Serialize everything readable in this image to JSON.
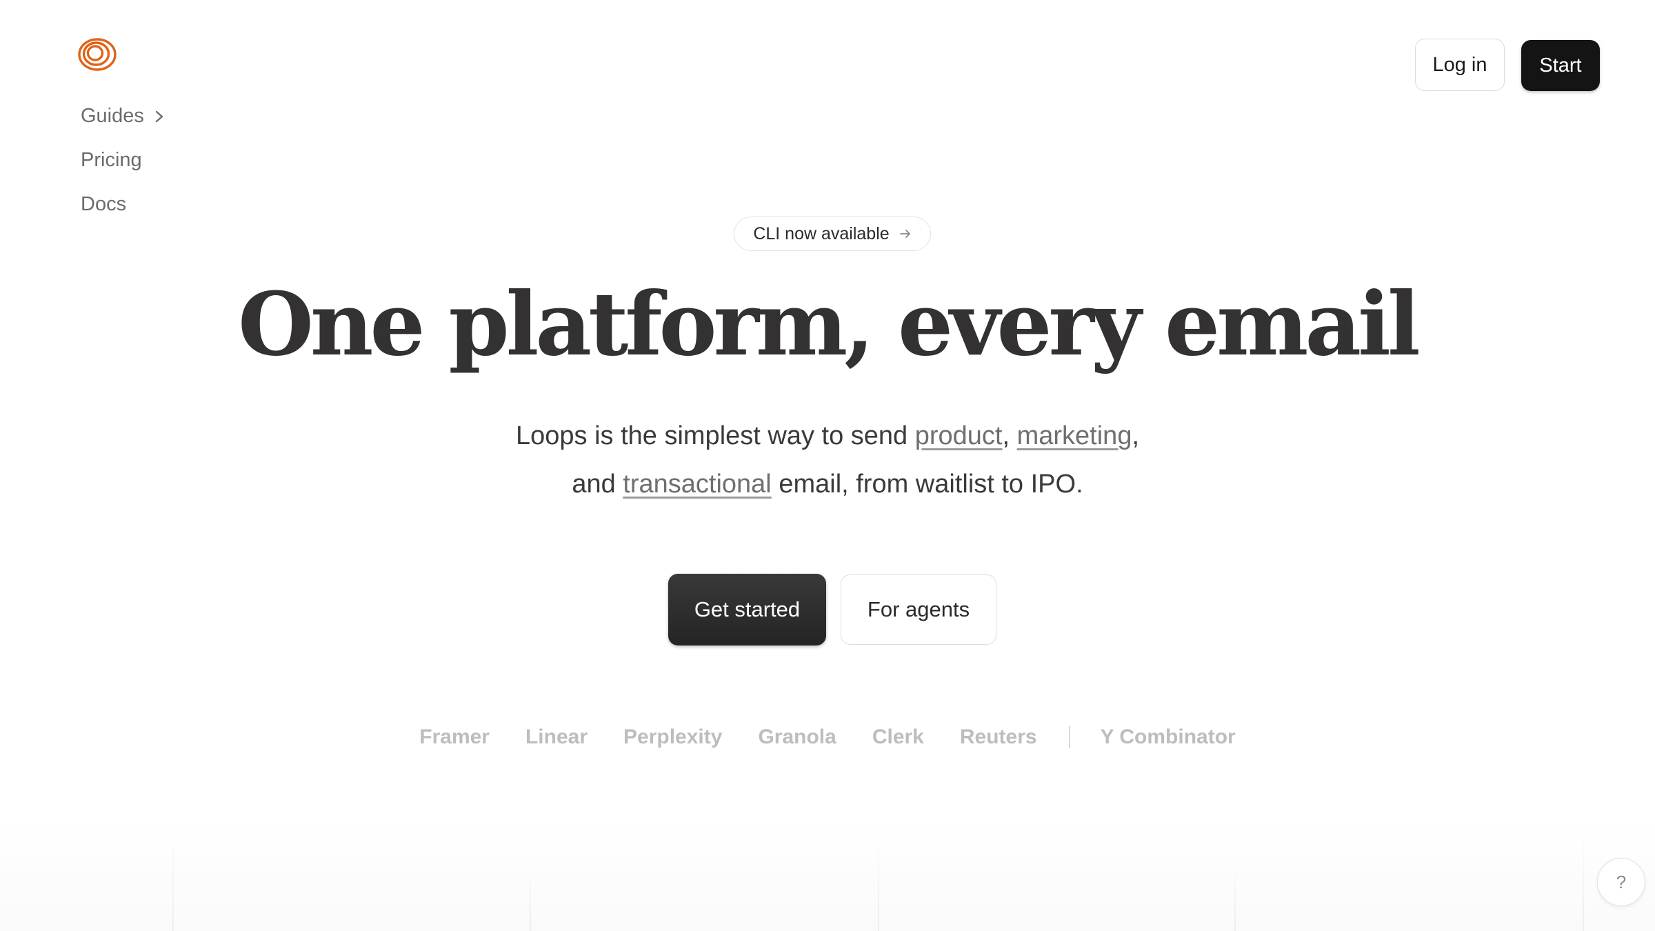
{
  "brand": {
    "logo_icon": "loops-rings-logo-icon",
    "accent_color": "#E0621A"
  },
  "nav": {
    "items": [
      {
        "label": "Guides",
        "icon": "chevron-right-icon"
      },
      {
        "label": "Pricing"
      },
      {
        "label": "Docs"
      }
    ]
  },
  "header": {
    "login_label": "Log in",
    "start_label": "Start"
  },
  "announcement": {
    "label": "CLI now available",
    "icon": "arrow-right-icon"
  },
  "hero": {
    "headline": "One platform, every email",
    "subtitle": {
      "part1": "Loops is the simplest way to send ",
      "link_product": "product",
      "comma1": ", ",
      "link_marketing": "marketing",
      "comma2": ",",
      "part2": "and ",
      "link_transactional": "transactional",
      "part3": " email, from waitlist to IPO."
    },
    "primary_cta": "Get started",
    "secondary_cta": "For agents"
  },
  "customers": {
    "logos": [
      "Framer",
      "Linear",
      "Perplexity",
      "Granola",
      "Clerk",
      "Reuters"
    ],
    "investor": "Y Combinator"
  },
  "help": {
    "label": "?"
  }
}
